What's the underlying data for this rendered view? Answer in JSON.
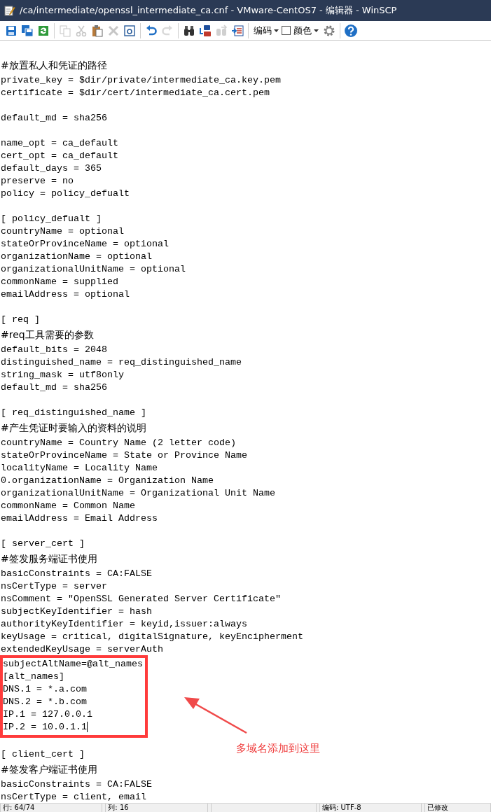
{
  "window": {
    "title": "/ca/intermediate/openssl_intermediate_ca.cnf - VMware-CentOS7 - 编辑器 - WinSCP"
  },
  "toolbar": {
    "groups": [
      [
        {
          "kind": "save",
          "disabled": false
        },
        {
          "kind": "save_all",
          "disabled": false
        },
        {
          "kind": "reload",
          "disabled": false
        }
      ],
      [
        {
          "kind": "copy",
          "disabled": true
        },
        {
          "kind": "cut",
          "disabled": true
        },
        {
          "kind": "paste",
          "disabled": false
        },
        {
          "kind": "delete",
          "disabled": true
        },
        {
          "kind": "select_all",
          "disabled": false
        }
      ],
      [
        {
          "kind": "undo",
          "disabled": false
        },
        {
          "kind": "redo",
          "disabled": true
        }
      ],
      [
        {
          "kind": "find",
          "disabled": false
        },
        {
          "kind": "replace",
          "disabled": false
        },
        {
          "kind": "find_next",
          "disabled": true
        },
        {
          "kind": "goto",
          "disabled": false
        }
      ]
    ],
    "encoding_menu": {
      "label": "编码"
    },
    "color_menu": {
      "label": "颜色",
      "checked": false
    }
  },
  "editor": {
    "lines_before": [
      {
        "kind": "comment",
        "text": "#放置私人和凭证的路径"
      },
      {
        "kind": "code",
        "text": "private_key = $dir/private/intermediate_ca.key.pem"
      },
      {
        "kind": "code",
        "text": "certificate = $dir/cert/intermediate_ca.cert.pem"
      },
      {
        "kind": "blank"
      },
      {
        "kind": "code",
        "text": "default_md = sha256"
      },
      {
        "kind": "blank"
      },
      {
        "kind": "code",
        "text": "name_opt = ca_default"
      },
      {
        "kind": "code",
        "text": "cert_opt = ca_default"
      },
      {
        "kind": "code",
        "text": "default_days = 365"
      },
      {
        "kind": "code",
        "text": "preserve = no"
      },
      {
        "kind": "code",
        "text": "policy = policy_defualt"
      },
      {
        "kind": "blank"
      },
      {
        "kind": "code",
        "text": "[ policy_defualt ]"
      },
      {
        "kind": "code",
        "text": "countryName = optional"
      },
      {
        "kind": "code",
        "text": "stateOrProvinceName = optional"
      },
      {
        "kind": "code",
        "text": "organizationName = optional"
      },
      {
        "kind": "code",
        "text": "organizationalUnitName = optional"
      },
      {
        "kind": "code",
        "text": "commonName = supplied"
      },
      {
        "kind": "code",
        "text": "emailAddress = optional"
      },
      {
        "kind": "blank"
      },
      {
        "kind": "code",
        "text": "[ req ]"
      },
      {
        "kind": "comment",
        "text": "#req工具需要的参数"
      },
      {
        "kind": "code",
        "text": "default_bits = 2048"
      },
      {
        "kind": "code",
        "text": "distinguished_name = req_distinguished_name"
      },
      {
        "kind": "code",
        "text": "string_mask = utf8only"
      },
      {
        "kind": "code",
        "text": "default_md = sha256"
      },
      {
        "kind": "blank"
      },
      {
        "kind": "code",
        "text": "[ req_distinguished_name ]"
      },
      {
        "kind": "comment",
        "text": "#产生凭证时要输入的资料的说明"
      },
      {
        "kind": "code",
        "text": "countryName = Country Name (2 letter code)"
      },
      {
        "kind": "code",
        "text": "stateOrProvinceName = State or Province Name"
      },
      {
        "kind": "code",
        "text": "localityName = Locality Name"
      },
      {
        "kind": "code",
        "text": "0.organizationName = Organization Name"
      },
      {
        "kind": "code",
        "text": "organizationalUnitName = Organizational Unit Name"
      },
      {
        "kind": "code",
        "text": "commonName = Common Name"
      },
      {
        "kind": "code",
        "text": "emailAddress = Email Address"
      },
      {
        "kind": "blank"
      },
      {
        "kind": "code",
        "text": "[ server_cert ]"
      },
      {
        "kind": "comment",
        "text": "#签发服务端证书使用"
      },
      {
        "kind": "code",
        "text": "basicConstraints = CA:FALSE"
      },
      {
        "kind": "code",
        "text": "nsCertType = server"
      },
      {
        "kind": "code",
        "text": "nsComment = \"OpenSSL Generated Server Certificate\""
      },
      {
        "kind": "code",
        "text": "subjectKeyIdentifier = hash"
      },
      {
        "kind": "code",
        "text": "authorityKeyIdentifier = keyid,issuer:always"
      },
      {
        "kind": "code",
        "text": "keyUsage = critical, digitalSignature, keyEncipherment"
      },
      {
        "kind": "code",
        "text": "extendedKeyUsage = serverAuth"
      }
    ],
    "boxed_lines": [
      {
        "text": "subjectAltName=@alt_names",
        "cursor": false
      },
      {
        "text": "[alt_names]",
        "cursor": false
      },
      {
        "text": "DNS.1 = *.a.com",
        "cursor": false
      },
      {
        "text": "DNS.2 = *.b.com",
        "cursor": false
      },
      {
        "text": "IP.1 = 127.0.0.1",
        "cursor": false
      },
      {
        "text": "IP.2 = 10.0.1.1",
        "cursor": true
      }
    ],
    "lines_after": [
      {
        "kind": "blank"
      },
      {
        "kind": "code",
        "text": "[ client_cert ]"
      },
      {
        "kind": "comment",
        "text": "#签发客户端证书使用"
      },
      {
        "kind": "code",
        "text": "basicConstraints = CA:FALSE"
      },
      {
        "kind": "code",
        "text": "nsCertType = client, email"
      }
    ],
    "annotation": {
      "text": "多域名添加到这里"
    }
  },
  "status_bar": [
    {
      "text": "行: 64/74"
    },
    {
      "text": "列: 16"
    },
    {
      "kind": "blank"
    },
    {
      "text": "编码: UTF-8"
    },
    {
      "text": "已修改"
    }
  ]
}
